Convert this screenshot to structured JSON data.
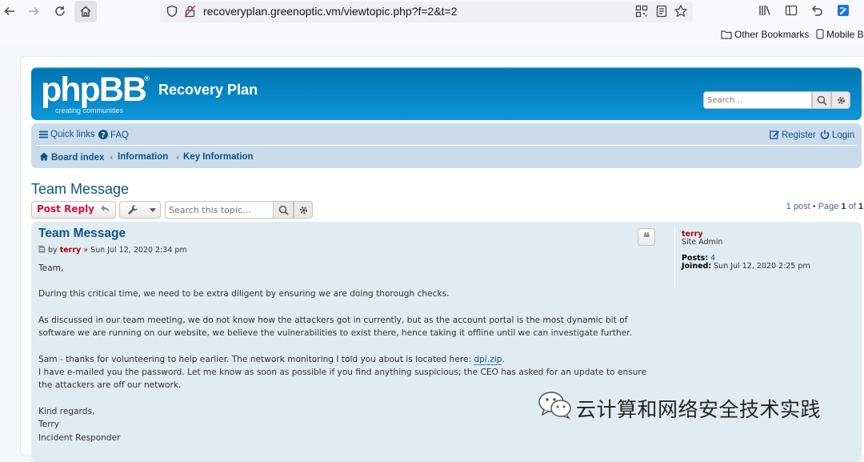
{
  "browser": {
    "url": "recoveryplan.greenoptic.vm/viewtopic.php?f=2&t=2",
    "bookmarks": [
      "Other Bookmarks",
      "Mobile B"
    ]
  },
  "header": {
    "logo_text": "phpBB",
    "logo_reg": "®",
    "logo_tagline": "creating   communities",
    "site_title": "Recovery Plan",
    "search_placeholder": "Search…"
  },
  "navbar": {
    "quick_links": "Quick links",
    "faq": "FAQ",
    "register": "Register",
    "login": "Login",
    "breadcrumbs": [
      "Board index",
      "Information",
      "Key Information"
    ]
  },
  "topic": {
    "title": "Team Message",
    "post_reply": "Post Reply",
    "search_placeholder": "Search this topic…",
    "pagination": {
      "prefix": "1 post • Page ",
      "current": "1",
      "of": " of ",
      "total": "1"
    }
  },
  "post": {
    "title": "Team Message",
    "by": "by",
    "author": "terry",
    "date": "» Sun Jul 12, 2020 2:34 pm",
    "greeting": "Team,",
    "p1": "During this critical time, we need to be extra diligent by ensuring we are doing thorough checks.",
    "p2": "As discussed in our team meeting, we do not know how the attackers got in currently, but as the account portal is the most dynamic bit of software we are running on our website, we believe the vulnerabilities to exist there, hence taking it offline until we can investigate further.",
    "p3_before_link": "Sam - thanks for volunteering to help earlier. The network monitoring I told you about is located here: ",
    "p3_link": "dpi.zip",
    "p3_after_link": ".",
    "p4": "I have e-mailed you the password. Let me know as soon as possible if you find anything suspicious; the CEO has asked for an update to ensure the attackers are off our network.",
    "closing": "Kind regards,",
    "sign_name": "Terry",
    "sign_title": "Incident Responder"
  },
  "profile": {
    "username": "terry",
    "rank": "Site Admin",
    "posts_label": "Posts:",
    "posts_value": "4",
    "joined_label": "Joined:",
    "joined_value": "Sun Jul 12, 2020 2:25 pm"
  },
  "watermark": {
    "text": "云计算和网络安全技术实践"
  }
}
